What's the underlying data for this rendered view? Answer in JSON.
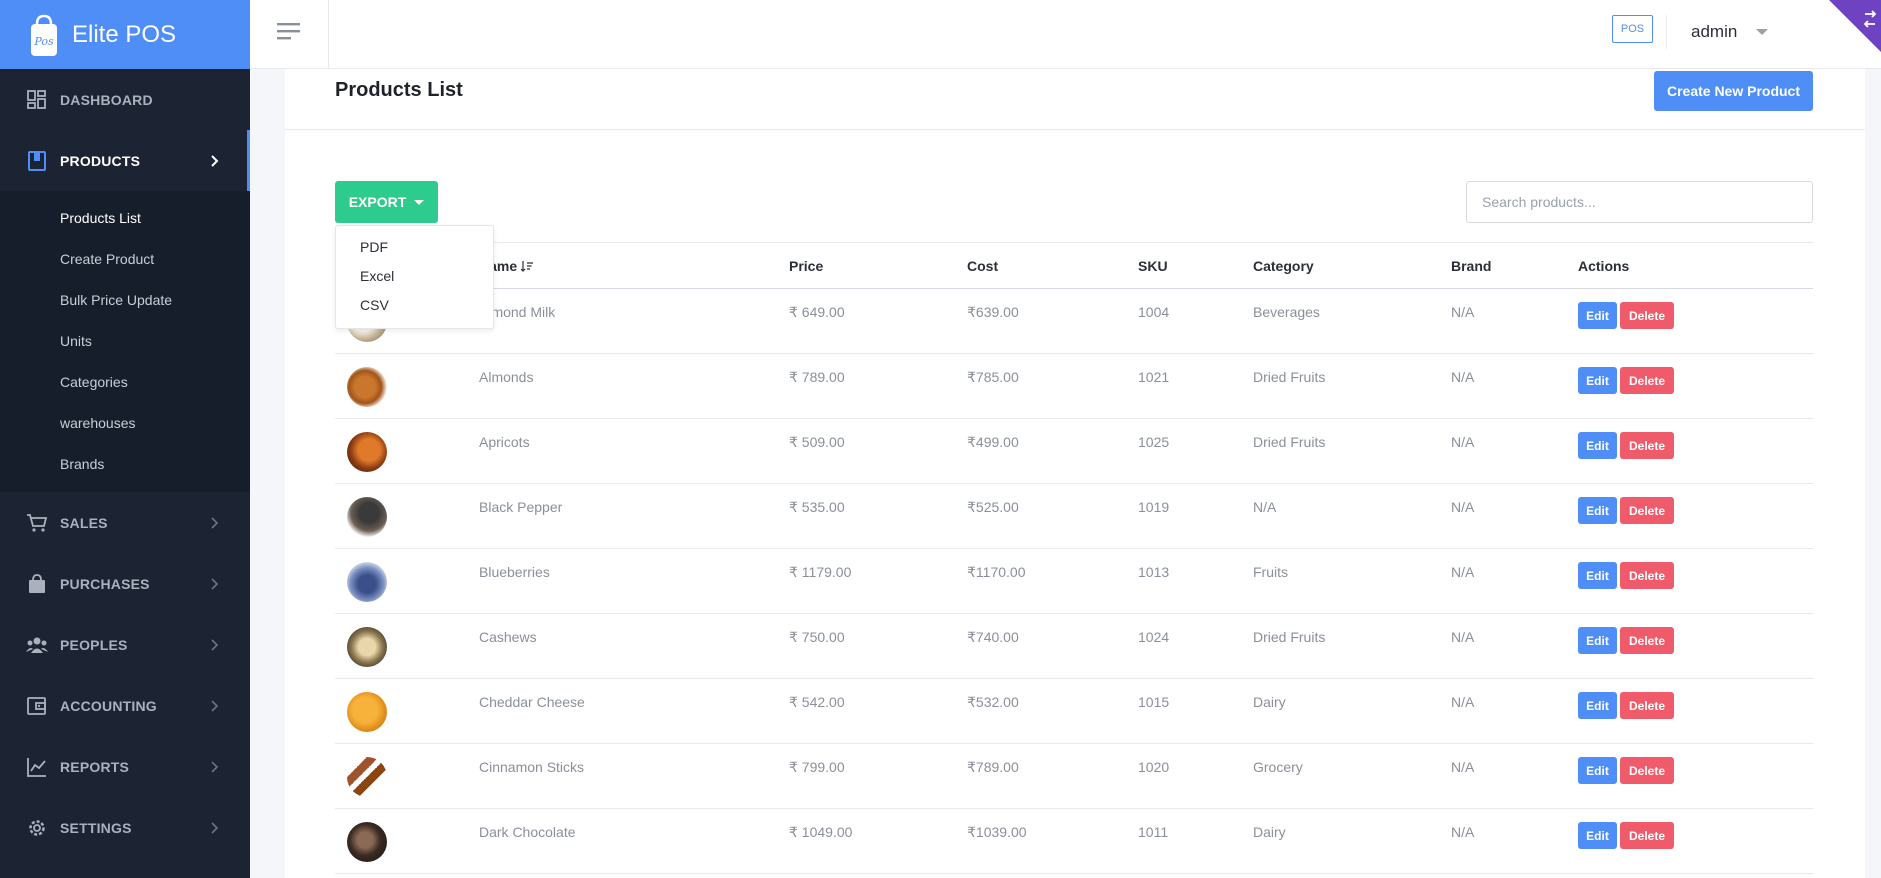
{
  "brand": {
    "name": "Elite POS"
  },
  "sidebar": {
    "items": [
      {
        "label": "DASHBOARD",
        "icon": "dashboard-icon"
      },
      {
        "label": "PRODUCTS",
        "icon": "product-icon",
        "active": true
      },
      {
        "label": "SALES",
        "icon": "cart-icon"
      },
      {
        "label": "PURCHASES",
        "icon": "bag-icon"
      },
      {
        "label": "PEOPLES",
        "icon": "people-icon"
      },
      {
        "label": "ACCOUNTING",
        "icon": "wallet-icon"
      },
      {
        "label": "REPORTS",
        "icon": "chart-icon"
      },
      {
        "label": "SETTINGS",
        "icon": "gear-icon"
      }
    ],
    "products_sub": [
      "Products List",
      "Create Product",
      "Bulk Price Update",
      "Units",
      "Categories",
      "warehouses",
      "Brands"
    ]
  },
  "header": {
    "pos_label": "POS",
    "user": "admin"
  },
  "page": {
    "title": "Products List",
    "create_label": "Create New Product",
    "export_label": "EXPORT",
    "search_placeholder": "Search products...",
    "export_options": [
      "PDF",
      "Excel",
      "CSV"
    ]
  },
  "table": {
    "headers": [
      "Name",
      "Price",
      "Cost",
      "SKU",
      "Category",
      "Brand",
      "Actions"
    ],
    "rows": [
      {
        "name": "Almond Milk",
        "price": "₹ 649.00",
        "cost": "₹639.00",
        "sku": "1004",
        "category": "Beverages",
        "brand": "N/A"
      },
      {
        "name": "Almonds",
        "price": "₹ 789.00",
        "cost": "₹785.00",
        "sku": "1021",
        "category": "Dried Fruits",
        "brand": "N/A"
      },
      {
        "name": "Apricots",
        "price": "₹ 509.00",
        "cost": "₹499.00",
        "sku": "1025",
        "category": "Dried Fruits",
        "brand": "N/A"
      },
      {
        "name": "Black Pepper",
        "price": "₹ 535.00",
        "cost": "₹525.00",
        "sku": "1019",
        "category": "N/A",
        "brand": "N/A"
      },
      {
        "name": "Blueberries",
        "price": "₹ 1179.00",
        "cost": "₹1170.00",
        "sku": "1013",
        "category": "Fruits",
        "brand": "N/A"
      },
      {
        "name": "Cashews",
        "price": "₹ 750.00",
        "cost": "₹740.00",
        "sku": "1024",
        "category": "Dried Fruits",
        "brand": "N/A"
      },
      {
        "name": "Cheddar Cheese",
        "price": "₹ 542.00",
        "cost": "₹532.00",
        "sku": "1015",
        "category": "Dairy",
        "brand": "N/A"
      },
      {
        "name": "Cinnamon Sticks",
        "price": "₹ 799.00",
        "cost": "₹789.00",
        "sku": "1020",
        "category": "Grocery",
        "brand": "N/A"
      },
      {
        "name": "Dark Chocolate",
        "price": "₹ 1049.00",
        "cost": "₹1039.00",
        "sku": "1011",
        "category": "Dairy",
        "brand": "N/A"
      }
    ],
    "edit_label": "Edit",
    "delete_label": "Delete"
  },
  "colors": {
    "primary": "#4f8ef7",
    "success": "#2ecb8f",
    "danger": "#ef5b6b",
    "sidebar": "#1c2434"
  }
}
